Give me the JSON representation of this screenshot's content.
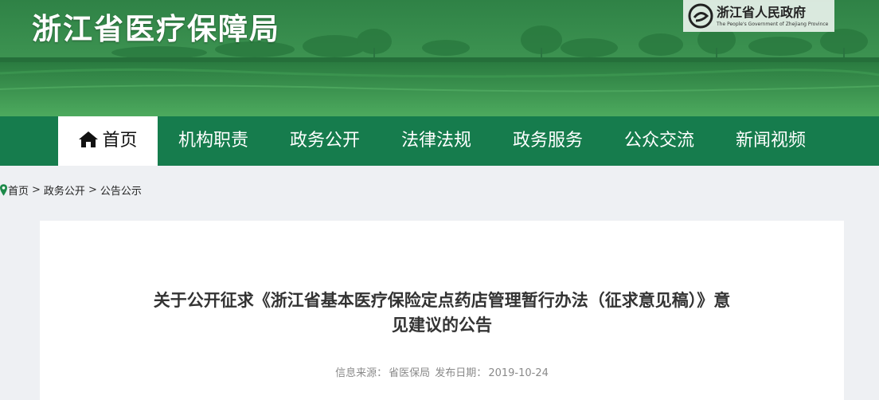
{
  "header": {
    "site_title": "浙江省医疗保障局",
    "gov_logo": {
      "name_cn": "浙江省人民政府",
      "name_en": "The People's Government of Zhejiang Province",
      "icon": "emblem-icon"
    }
  },
  "nav": {
    "items": [
      {
        "label": "首页",
        "icon": "home-icon",
        "active": true
      },
      {
        "label": "机构职责"
      },
      {
        "label": "政务公开"
      },
      {
        "label": "法律法规"
      },
      {
        "label": "政务服务"
      },
      {
        "label": "公众交流"
      },
      {
        "label": "新闻视频"
      }
    ]
  },
  "breadcrumb": {
    "icon": "location-pin-icon",
    "items": [
      "首页",
      "政务公开",
      "公告公示"
    ],
    "separator": ">"
  },
  "article": {
    "title_line1": "关于公开征求《浙江省基本医疗保险定点药店管理暂行办法（征求意见稿）》意",
    "title_line2": "见建议的公告",
    "source_label": "信息来源：",
    "source_value": "省医保局",
    "date_label": "发布日期：",
    "date_value": "2019-10-24"
  },
  "colors": {
    "nav_bg": "#167c4d",
    "banner_green": "#3b9a52",
    "page_bg": "#eef0f3"
  }
}
